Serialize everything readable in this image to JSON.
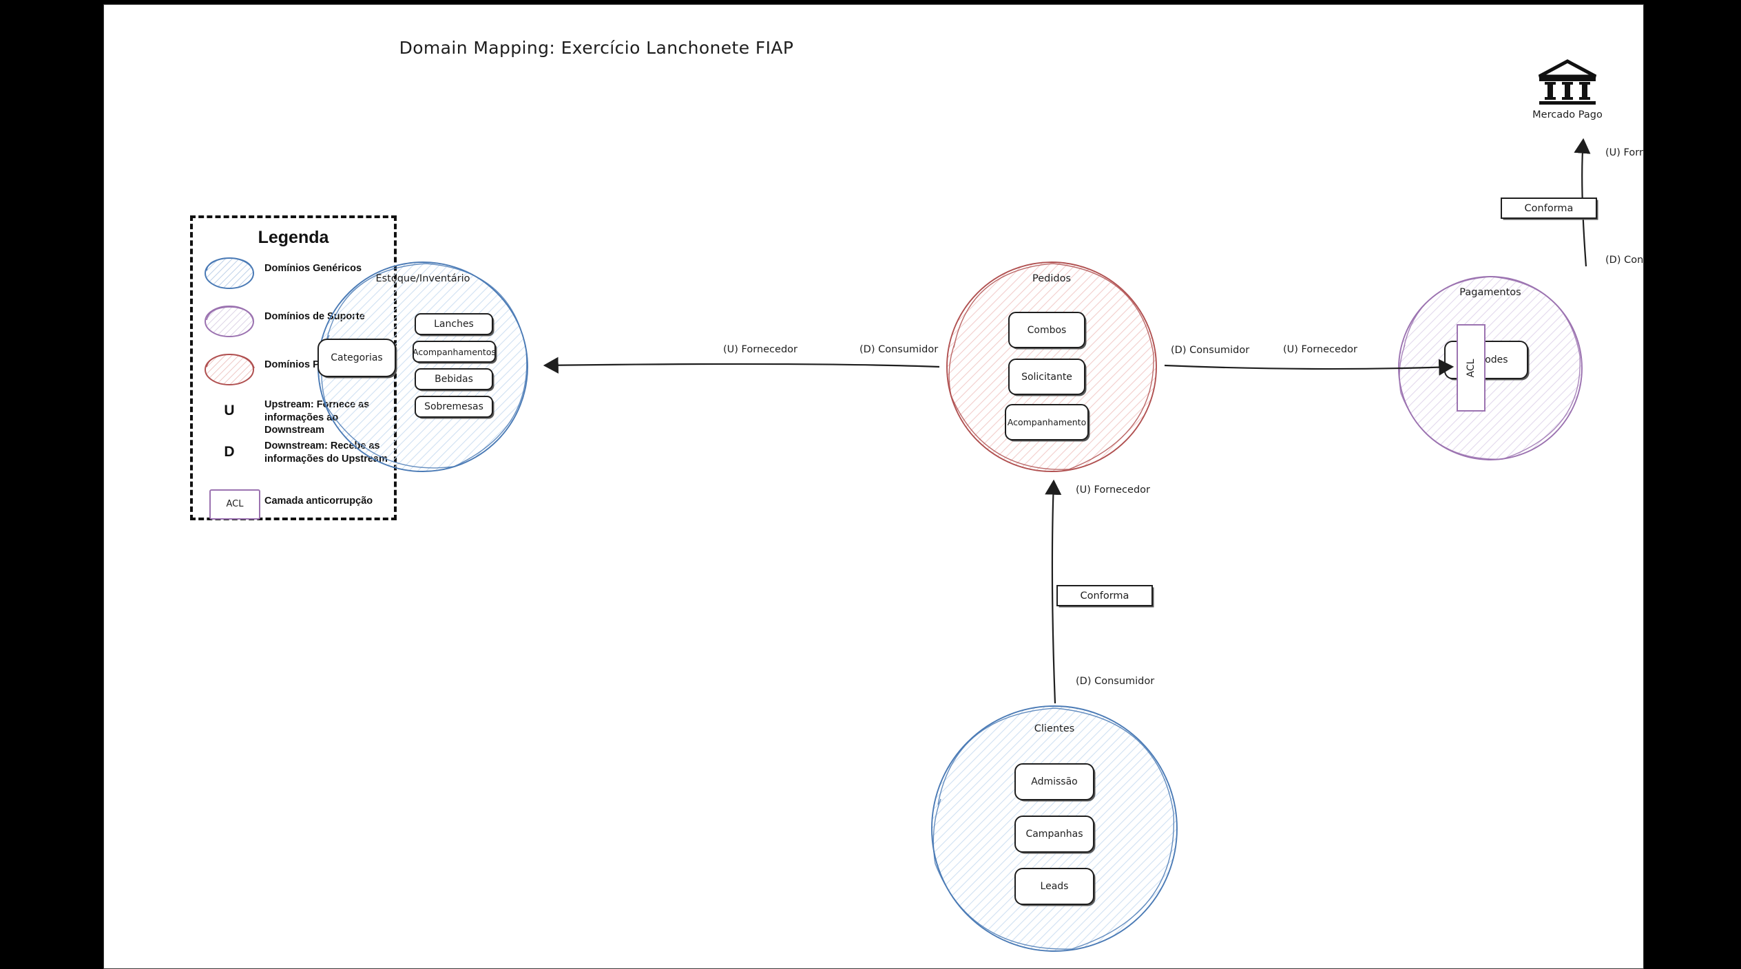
{
  "diagram": {
    "title": "Domain Mapping: Exercício Lanchonete FIAP"
  },
  "legend": {
    "title": "Legenda",
    "items": [
      {
        "swatch": "ellipse-blue",
        "label": "Domínios Genéricos"
      },
      {
        "swatch": "ellipse-purple",
        "label": "Domínios de Suporte"
      },
      {
        "swatch": "ellipse-red",
        "label": "Domínios Principais"
      },
      {
        "swatch": "letter-u",
        "letter": "U",
        "label": "Upstream: Fornece as informações ao Downstream"
      },
      {
        "swatch": "letter-d",
        "letter": "D",
        "label": "Downstream: Recebe as informações do Upstream"
      },
      {
        "swatch": "acl-box",
        "box_label": "ACL",
        "label": "Camada anticorrupção"
      }
    ]
  },
  "domains": [
    {
      "id": "estoque",
      "title": "Estoque/Inventário",
      "kind": "generic",
      "color": "#4a7ab5",
      "boxes": [
        "Categorias",
        "Lanches",
        "Acompanhamentos",
        "Bebidas",
        "Sobremesas"
      ]
    },
    {
      "id": "pedidos",
      "title": "Pedidos",
      "kind": "core",
      "color": "#b05050",
      "boxes": [
        "Combos",
        "Solicitante",
        "Acompanhamento"
      ]
    },
    {
      "id": "pagamentos",
      "title": "Pagamentos",
      "kind": "support",
      "color": "#9b72b0",
      "boxes": [
        "QRCodes"
      ]
    },
    {
      "id": "clientes",
      "title": "Clientes",
      "kind": "generic",
      "color": "#4a7ab5",
      "boxes": [
        "Admissão",
        "Campanhas",
        "Leads"
      ]
    }
  ],
  "external": {
    "mercado_pago": {
      "label": "Mercado Pago",
      "icon": "bank-icon"
    }
  },
  "acl": {
    "pagamentos_label": "ACL"
  },
  "connections": {
    "pedidos_to_estoque": {
      "upstream_label": "(U) Fornecedor",
      "downstream_label": "(D) Consumidor"
    },
    "pedidos_to_pagamentos": {
      "downstream_label": "(D) Consumidor",
      "upstream_label": "(U) Fornecedor"
    },
    "clientes_to_pedidos": {
      "upstream_label": "(U) Fornecedor",
      "downstream_label": "(D) Consumidor",
      "pattern_label": "Conforma"
    },
    "pagamentos_to_mercadopago": {
      "upstream_label": "(U) Fornecedor",
      "downstream_label": "(D) Consumidor",
      "pattern_label": "Conforma"
    }
  }
}
